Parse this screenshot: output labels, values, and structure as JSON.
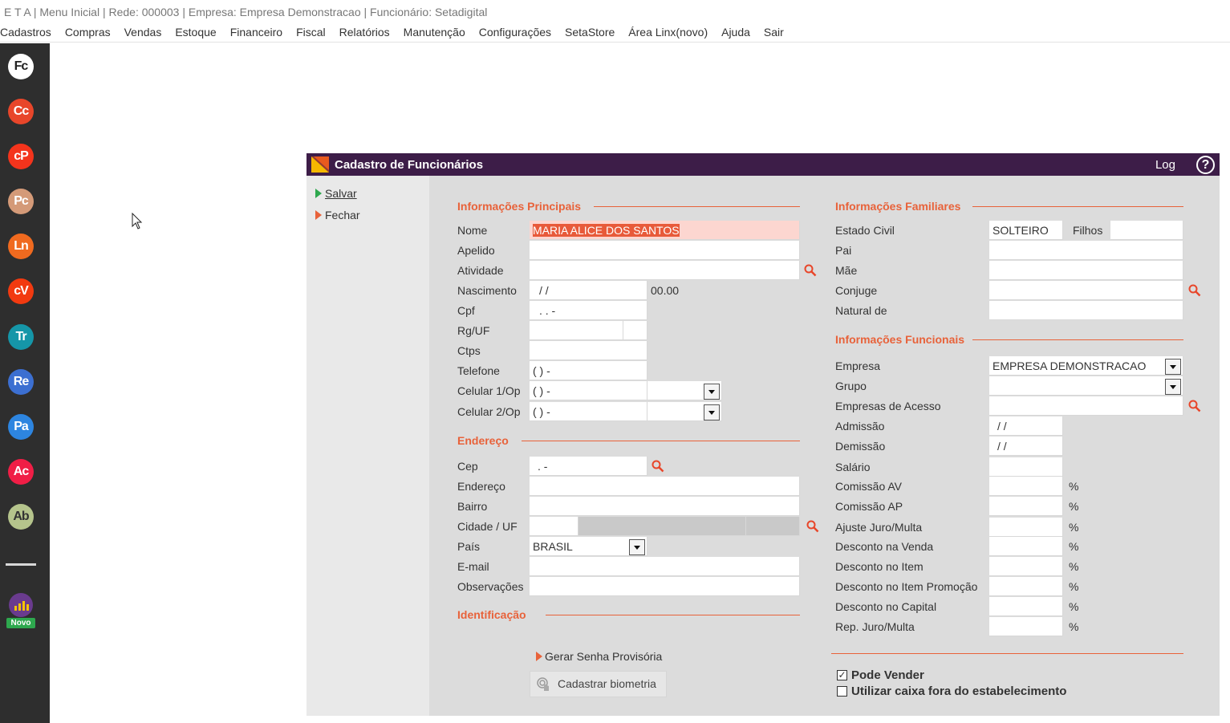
{
  "titlebar": {
    "text": "E T A | Menu Inicial | Rede: 000003 | Empresa: Empresa Demonstracao | Funcionário: Setadigital"
  },
  "menu": [
    "Cadastros",
    "Compras",
    "Vendas",
    "Estoque",
    "Financeiro",
    "Fiscal",
    "Relatórios",
    "Manutenção",
    "Configurações",
    "SetaStore",
    "Área Linx(novo)",
    "Ajuda",
    "Sair"
  ],
  "sidebar": {
    "buttons": [
      {
        "label": "Fc",
        "color": "#ffffff",
        "text_color": "#222222"
      },
      {
        "label": "Cc",
        "color": "#e8462a",
        "text_color": "#ffffff"
      },
      {
        "label": "cP",
        "color": "#f4341c",
        "text_color": "#ffffff"
      },
      {
        "label": "Pc",
        "color": "#d49a78",
        "text_color": "#ffffff"
      },
      {
        "label": "Ln",
        "color": "#f06a1f",
        "text_color": "#ffffff"
      },
      {
        "label": "cV",
        "color": "#f23a10",
        "text_color": "#ffffff"
      },
      {
        "label": "Tr",
        "color": "#1596a8",
        "text_color": "#ffffff"
      },
      {
        "label": "Re",
        "color": "#3c6fd1",
        "text_color": "#ffffff"
      },
      {
        "label": "Pa",
        "color": "#2d85e0",
        "text_color": "#ffffff"
      },
      {
        "label": "Ac",
        "color": "#f01e46",
        "text_color": "#ffffff"
      },
      {
        "label": "Ab",
        "color": "#b5c48c",
        "text_color": "#333333"
      }
    ],
    "novo_label": "Novo"
  },
  "window": {
    "title": "Cadastro de Funcionários",
    "log": "Log",
    "help": "?",
    "actions": {
      "salvar": {
        "label": "Salvar",
        "color": "#2ea84e"
      },
      "fechar": {
        "label": "Fechar",
        "color": "#e8623a"
      }
    }
  },
  "principais": {
    "heading": "Informações Principais",
    "nome": {
      "label": "Nome",
      "value": "MARIA ALICE DOS SANTOS"
    },
    "apelido": {
      "label": "Apelido",
      "value": ""
    },
    "atividade": {
      "label": "Atividade",
      "value": ""
    },
    "nascimento": {
      "label": "Nascimento",
      "value": " /  /",
      "extra": "00.00"
    },
    "cpf": {
      "label": "Cpf",
      "value": "  .   .   -"
    },
    "rg": {
      "label": "Rg/UF",
      "value": ""
    },
    "ctps": {
      "label": "Ctps",
      "value": ""
    },
    "telefone": {
      "label": "Telefone",
      "value": "(  )    -"
    },
    "celular1": {
      "label": "Celular 1/Op",
      "value": "(  )    -"
    },
    "celular2": {
      "label": "Celular 2/Op",
      "value": "(  )    -"
    }
  },
  "endereco": {
    "heading": "Endereço",
    "cep": {
      "label": "Cep",
      "value": "  .   -"
    },
    "endereco": {
      "label": "Endereço",
      "value": ""
    },
    "bairro": {
      "label": "Bairro",
      "value": ""
    },
    "cidade": {
      "label": "Cidade / UF",
      "value": ""
    },
    "pais": {
      "label": "País",
      "value": "BRASIL"
    },
    "email": {
      "label": "E-mail",
      "value": ""
    },
    "obs": {
      "label": "Observações",
      "value": ""
    }
  },
  "identificacao": {
    "heading": "Identificação",
    "gerar_senha": "Gerar Senha Provisória",
    "biometria": "Cadastrar biometria"
  },
  "familiares": {
    "heading": "Informações Familiares",
    "estado_civil": {
      "label": "Estado Civil",
      "value": "SOLTEIRO"
    },
    "filhos": {
      "label": "Filhos",
      "value": ""
    },
    "pai": {
      "label": "Pai",
      "value": ""
    },
    "mae": {
      "label": "Mãe",
      "value": ""
    },
    "conjuge": {
      "label": "Conjuge",
      "value": ""
    },
    "natural": {
      "label": "Natural de",
      "value": ""
    }
  },
  "funcionais": {
    "heading": "Informações Funcionais",
    "empresa": {
      "label": "Empresa",
      "value": "EMPRESA DEMONSTRACAO"
    },
    "grupo": {
      "label": "Grupo",
      "value": ""
    },
    "empresas_acesso": {
      "label": "Empresas de Acesso",
      "value": ""
    },
    "admissao": {
      "label": "Admissão",
      "value": " /  /"
    },
    "demissao": {
      "label": "Demissão",
      "value": " /  /"
    },
    "salario": {
      "label": "Salário",
      "value": ""
    },
    "percent_fields": [
      {
        "label": "Comissão AV",
        "value": "",
        "unit": "%"
      },
      {
        "label": "Comissão AP",
        "value": "",
        "unit": "%"
      },
      {
        "label": "Ajuste Juro/Multa",
        "value": "",
        "unit": "%"
      },
      {
        "label": "Desconto na Venda",
        "value": "",
        "unit": "%"
      },
      {
        "label": "Desconto no Item",
        "value": "",
        "unit": "%"
      },
      {
        "label": "Desconto no Item Promoção",
        "value": "",
        "unit": "%"
      },
      {
        "label": "Desconto no Capital",
        "value": "",
        "unit": "%"
      },
      {
        "label": "Rep. Juro/Multa",
        "value": "",
        "unit": "%"
      }
    ]
  },
  "checks": {
    "pode_vender": {
      "label": "Pode Vender",
      "checked": true
    },
    "caixa_fora": {
      "label": "Utilizar caixa fora do estabelecimento",
      "checked": false
    }
  },
  "colors": {
    "accent": "#e8623a",
    "titlebar": "#3d1d48",
    "selection": "#e85a3a"
  }
}
